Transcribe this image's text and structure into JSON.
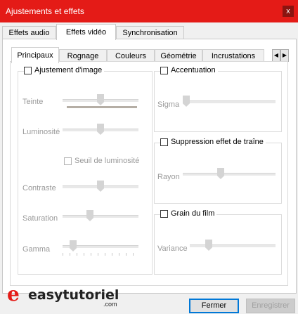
{
  "window": {
    "title": "Ajustements et effets",
    "close_glyph": "x"
  },
  "outer_tabs": [
    "Effets audio",
    "Effets vidéo",
    "Synchronisation"
  ],
  "inner_tabs": [
    "Principaux",
    "Rognage",
    "Couleurs",
    "Géométrie",
    "Incrustations"
  ],
  "scroll": {
    "left": "◀",
    "right": "▶"
  },
  "image_adjust": {
    "title": "Ajustement d'image",
    "checked": false,
    "teinte": "Teinte",
    "luminosite": "Luminosité",
    "seuil": "Seuil de luminosité",
    "contraste": "Contraste",
    "saturation": "Saturation",
    "gamma": "Gamma",
    "levels": {
      "teinte": 0.5,
      "luminosite": 0.5,
      "contraste": 0.5,
      "saturation": 0.35,
      "gamma": 0.1
    }
  },
  "accentuation": {
    "title": "Accentuation",
    "checked": false,
    "sigma": "Sigma",
    "level": 0.0
  },
  "suppression": {
    "title": "Suppression effet de traîne",
    "checked": false,
    "rayon": "Rayon",
    "level": 0.4
  },
  "grain": {
    "title": "Grain du film",
    "checked": false,
    "variance": "Variance",
    "level": 0.2
  },
  "buttons": {
    "close": "Fermer",
    "save": "Enregistrer"
  },
  "logo": {
    "text": "easytutoriel",
    "sub": ".com"
  },
  "colors": {
    "titlebar": "#e41b17",
    "primary_border": "#0078d7",
    "logo": "#e41b17"
  }
}
